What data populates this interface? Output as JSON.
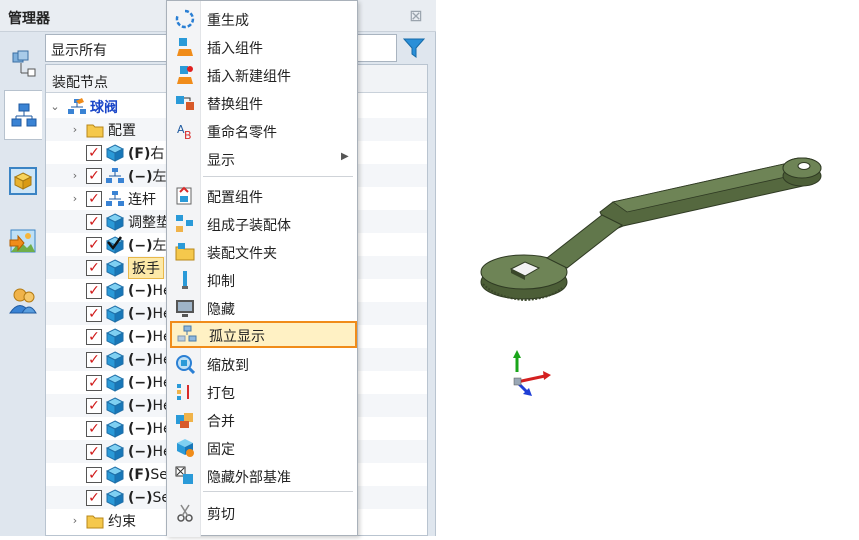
{
  "manager": {
    "title": "管理器",
    "close_icon": "close-icon",
    "filter_value": "显示所有",
    "tree_header": "装配节点",
    "tabs": [
      "assembly-structure-icon",
      "history-tree-icon",
      "part-cube-icon",
      "image-export-icon",
      "user-icon"
    ]
  },
  "tree": {
    "root": "球阀",
    "config": "配置",
    "rows": [
      {
        "prefix": "(F)",
        "text": "右"
      },
      {
        "prefix": "(−)",
        "text": "左"
      },
      {
        "prefix": "",
        "text": "连杆"
      },
      {
        "prefix": "",
        "text": "调整垫"
      },
      {
        "prefix": "(−)",
        "text": "左"
      },
      {
        "prefix": "",
        "text": "扳手"
      },
      {
        "prefix": "(−)",
        "text": "He"
      },
      {
        "prefix": "(−)",
        "text": "He"
      },
      {
        "prefix": "(−)",
        "text": "He"
      },
      {
        "prefix": "(−)",
        "text": "He"
      },
      {
        "prefix": "(−)",
        "text": "He"
      },
      {
        "prefix": "(−)",
        "text": "He"
      },
      {
        "prefix": "(−)",
        "text": "He"
      },
      {
        "prefix": "(−)",
        "text": "He"
      },
      {
        "prefix": "(F)",
        "text": "Se"
      },
      {
        "prefix": "(−)",
        "text": "Se"
      }
    ],
    "constraint": "约束"
  },
  "context_menu": {
    "items": [
      {
        "label": "重生成",
        "icon": "regenerate-icon"
      },
      {
        "label": "插入组件",
        "icon": "insert-component-icon"
      },
      {
        "label": "插入新建组件",
        "icon": "insert-new-component-icon"
      },
      {
        "label": "替换组件",
        "icon": "replace-component-icon"
      },
      {
        "label": "重命名零件",
        "icon": "rename-part-icon"
      },
      {
        "label": "显示",
        "icon": "",
        "submenu": true
      },
      {
        "label": "配置组件",
        "icon": "configure-component-icon"
      },
      {
        "label": "组成子装配体",
        "icon": "make-subassembly-icon"
      },
      {
        "label": "装配文件夹",
        "icon": "assembly-folder-icon"
      },
      {
        "label": "抑制",
        "icon": "suppress-icon"
      },
      {
        "label": "隐藏",
        "icon": "hide-icon"
      },
      {
        "label": "孤立显示",
        "icon": "isolate-icon"
      },
      {
        "label": "缩放到",
        "icon": "zoom-to-icon"
      },
      {
        "label": "打包",
        "icon": "pack-icon"
      },
      {
        "label": "合并",
        "icon": "merge-icon"
      },
      {
        "label": "固定",
        "icon": "fix-icon"
      },
      {
        "label": "隐藏外部基准",
        "icon": "hide-external-datum-icon"
      },
      {
        "label": "剪切",
        "icon": "cut-icon"
      }
    ],
    "highlighted": "孤立显示"
  },
  "colors": {
    "accent_orange": "#f08c1a",
    "part_green": "#5a6e4a",
    "tree_root_blue": "#1a46c8",
    "check_red": "#d01818"
  }
}
